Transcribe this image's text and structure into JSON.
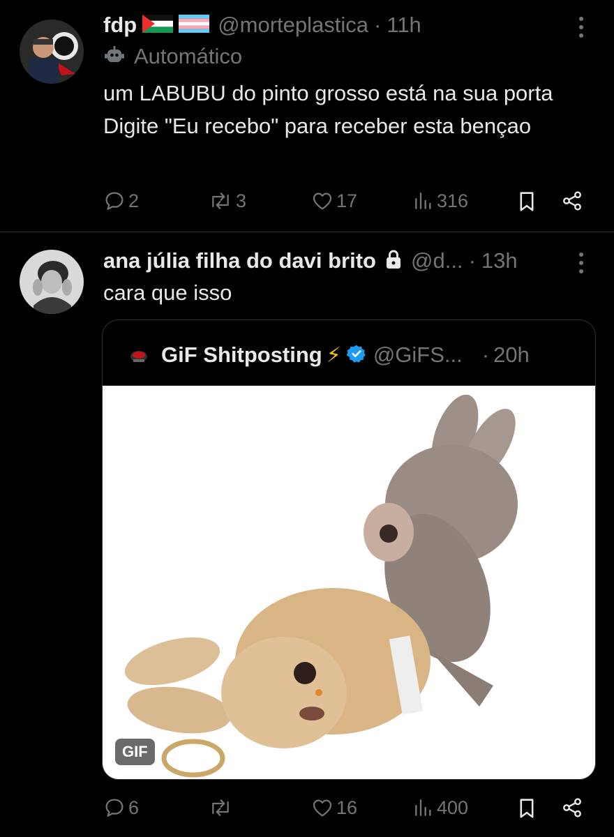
{
  "tweet1": {
    "display_name": "fdp",
    "flags": [
      "palestine-flag",
      "trans-flag"
    ],
    "handle": "@morteplastica",
    "separator": "·",
    "time": "11h",
    "automated_label": "Automático",
    "text": "um LABUBU do pinto grosso está na sua porta  Digite \"Eu recebo\" para receber esta bençao",
    "replies": "2",
    "retweets": "3",
    "likes": "17",
    "views": "316"
  },
  "tweet2": {
    "display_name": "ana júlia filha do davi brito",
    "handle": "@d...",
    "separator": "·",
    "time": "13h",
    "text": "cara que isso",
    "replies": "6",
    "retweets": "",
    "likes": "16",
    "views": "400",
    "quote": {
      "display_name": "GiF Shitposting",
      "emoji": "⚡",
      "handle": "@GiFS...",
      "separator": "·",
      "time": "20h",
      "media_badge": "GIF"
    }
  },
  "colors": {
    "background": "#000000",
    "text": "#e7e9ea",
    "muted": "#71767b",
    "verified": "#1d9bf0",
    "divider": "#2f3336"
  }
}
